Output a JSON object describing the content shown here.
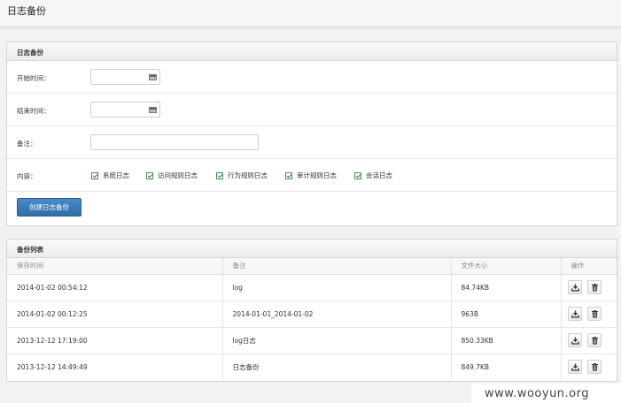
{
  "page": {
    "title": "日志备份"
  },
  "form_panel": {
    "title": "日志备份",
    "start_label": "开始时间：",
    "start_value": "",
    "end_label": "结束时间：",
    "end_value": "",
    "note_label": "备注：",
    "note_value": "",
    "content_label": "内容：",
    "options": [
      {
        "label": "系统日志",
        "checked": true
      },
      {
        "label": "访问规则日志",
        "checked": true
      },
      {
        "label": "行为规则日志",
        "checked": true
      },
      {
        "label": "审计规则日志",
        "checked": true
      },
      {
        "label": "会话日志",
        "checked": true
      }
    ],
    "submit_label": "创建日志备份",
    "calendar_icon": "calendar-icon"
  },
  "list_panel": {
    "title": "备份列表",
    "columns": [
      "保存时间",
      "备注",
      "文件大小",
      "操作"
    ],
    "rows": [
      {
        "time": "2014-01-02 00:54:12",
        "note": "log",
        "size": "84.74KB"
      },
      {
        "time": "2014-01-02 00:12:25",
        "note": "2014-01-01_2014-01-02",
        "size": "963B"
      },
      {
        "time": "2013-12-12 17:19:00",
        "note": "log日志",
        "size": "850.33KB"
      },
      {
        "time": "2013-12-12 14:49:49",
        "note": "日志备份",
        "size": "849.7KB"
      }
    ],
    "action_icons": [
      "download-icon",
      "trash-icon"
    ]
  },
  "watermark": "www.wooyun.org",
  "colors": {
    "primary_button": "#3a7cb8",
    "checkbox_border": "#4d8a52",
    "panel_header": "#efefef",
    "page_background": "#f2f2f2"
  }
}
